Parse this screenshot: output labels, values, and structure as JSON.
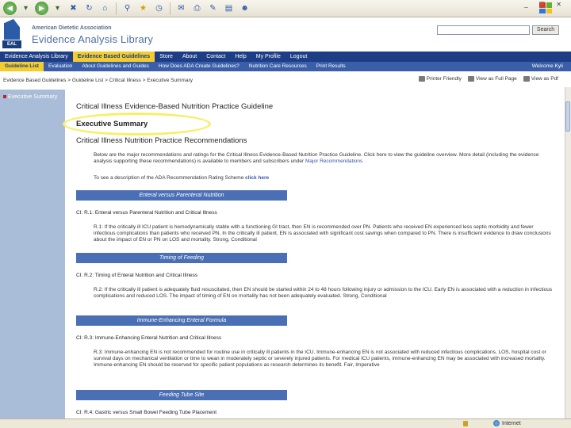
{
  "browser": {
    "toolbar_icons": [
      "back-icon",
      "forward-icon",
      "stop-icon",
      "refresh-icon",
      "home-icon",
      "search-icon",
      "favorites-icon",
      "history-icon",
      "mail-icon",
      "print-icon",
      "edit-icon",
      "discuss-icon",
      "messenger-icon"
    ],
    "window_controls": "_ ☐ ✕"
  },
  "header": {
    "org_name": "American Dietetic Association",
    "library_name": "Evidence Analysis Library",
    "logo_text": "EAL",
    "search_placeholder": "",
    "search_button": "Search"
  },
  "main_nav": [
    {
      "label": "Evidence Analysis Library",
      "active": false
    },
    {
      "label": "Evidence Based Guidelines",
      "active": true
    },
    {
      "label": "Store",
      "active": false
    },
    {
      "label": "About",
      "active": false
    },
    {
      "label": "Contact",
      "active": false
    },
    {
      "label": "Help",
      "active": false
    },
    {
      "label": "My Profile",
      "active": false
    },
    {
      "label": "Logout",
      "active": false
    }
  ],
  "sub_nav": {
    "items": [
      {
        "label": "Guideline List",
        "active": true
      },
      {
        "label": "Evaluation",
        "active": false
      },
      {
        "label": "About Guidelines and Guides",
        "active": false
      },
      {
        "label": "How Does ADA Create Guidelines?",
        "active": false
      },
      {
        "label": "Nutrition Care Resources",
        "active": false
      },
      {
        "label": "Print Results",
        "active": false
      }
    ],
    "welcome": "Welcome Kyli"
  },
  "breadcrumb": "Evidence Based Guidelines > Guideline List > Critical Illness > Executive Summary",
  "tools": {
    "printer_friendly": "Printer Friendly",
    "full_page": "View as Full Page",
    "view_pdf": "View as Pdf"
  },
  "sidebar": {
    "item_label": "Executive Summary"
  },
  "content": {
    "page_title": "Critical Illness Evidence-Based Nutrition Practice Guideline",
    "exec_summary": "Executive Summary",
    "recommendations_title": "Critical Illness Nutrition Practice Recommendations",
    "intro_text": "Below are the major recommendations and ratings for the Critical Illness Evidence-Based Nutrition Practice Guideline. Click here to view the guideline overview. More detail (including the evidence analysis supporting these recommendations) is available to members and subscribers under",
    "intro_link": "Major Recommendations",
    "desc_prefix": "To see a description of the ADA Recommendation Rating Scheme",
    "desc_link": "click here",
    "sections": [
      {
        "bar": "Enteral versus Parenteral Nutrition",
        "heading": "CI: R.1: Enteral versus Parenteral Nutrition and Critical Illness",
        "body": "R.1: If the critically ill ICU patient is hemodynamically stable with a functioning GI tract, then EN is recommended over PN. Patients who received EN experienced less septic morbidity and fewer infectious complications than patients who received PN. In the critically ill patient, EN is associated with significant cost savings when compared to PN. There is insufficient evidence to draw conclusions about the impact of EN or PN on LOS and mortality. Strong, Conditional"
      },
      {
        "bar": "Timing of Feeding",
        "heading": "CI: R.2: Timing of Enteral Nutrition and Critical Illness",
        "body": "R.2: If the critically ill patient is adequately fluid resuscitated, then EN should be started within 24 to 48 hours following injury or admission to the ICU. Early EN is associated with a reduction in infectious complications and reduced LOS. The impact of timing of EN on mortality has not been adequately evaluated. Strong, Conditional"
      },
      {
        "bar": "Immune-Enhancing Enteral Formula",
        "heading": "CI: R.3: Immune-Enhancing Enteral Nutrition and Critical Illness",
        "body": "R.3: Immune-enhancing EN is not recommended for routine use in critically ill patients in the ICU. Immune-enhancing EN is not associated with reduced infectious complications, LOS, hospital cost or survival days on mechanical ventilation or time to wean in moderately septic or severely injured patients. For medical ICU patients, immune-enhancing EN may be associated with increased mortality. Immune-enhancing EN should be reserved for specific patient populations as research determines its benefit. Fair, Imperative"
      },
      {
        "bar": "Feeding Tube Site",
        "heading": "CI: R.4: Gastric versus Small Bowel Feeding Tube Placement",
        "body": ""
      }
    ]
  },
  "status": {
    "zone": "Internet"
  }
}
